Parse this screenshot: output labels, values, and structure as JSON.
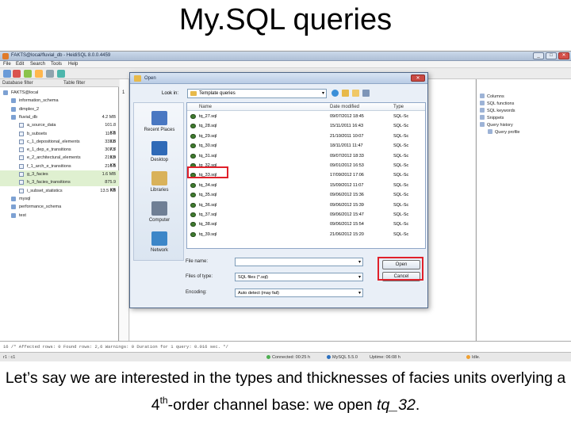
{
  "slide": {
    "title": "My.SQL queries",
    "caption_part1": "Let’s say we are interested in the types and thicknesses of facies units overlying a 4",
    "caption_sup": "th",
    "caption_part2": "-order channel base: we open ",
    "caption_em": "tq_32",
    "caption_end": "."
  },
  "app": {
    "window_title": "FAKTS@local/fluvial_db - HeidiSQL 8.0.0.4459",
    "menu": [
      "File",
      "Edit",
      "Search",
      "Tools",
      "Help"
    ],
    "filter_db": "Database filter",
    "filter_table": "Table filter",
    "tree": [
      {
        "name": "FAKTS@local",
        "size": "",
        "level": 0
      },
      {
        "name": "information_schema",
        "size": "",
        "level": 1
      },
      {
        "name": "dimplex_2",
        "size": "",
        "level": 1
      },
      {
        "name": "fluvial_db",
        "size": "4.2 MB",
        "level": 1
      },
      {
        "name": "a_source_data",
        "size": "101.8 KB",
        "level": 2
      },
      {
        "name": "b_subsets",
        "size": "110.6 KB",
        "level": 2
      },
      {
        "name": "c_1_depositional_elements",
        "size": "333.8 KB",
        "level": 2
      },
      {
        "name": "e_1_dep_e_transitions",
        "size": "307.7 KB",
        "level": 2
      },
      {
        "name": "e_2_architectural_elements",
        "size": "219.9 KB",
        "level": 2
      },
      {
        "name": "f_1_arch_e_transitions",
        "size": "216.5 KB",
        "level": 2
      },
      {
        "name": "g_3_facies",
        "size": "1.6 MB",
        "level": 2
      },
      {
        "name": "h_3_facies_transitions",
        "size": "875.9 KB",
        "level": 2
      },
      {
        "name": "i_subset_statistics",
        "size": "13.5 KB",
        "level": 2
      },
      {
        "name": "mysql",
        "size": "",
        "level": 1
      },
      {
        "name": "performance_schema",
        "size": "",
        "level": 1
      },
      {
        "name": "test",
        "size": "",
        "level": 1
      }
    ],
    "line_number": "1",
    "helpers": [
      "Columns",
      "SQL functions",
      "SQL keywords",
      "Snippets",
      "Query history",
      "Query profile"
    ],
    "log_text": "16 /* Affected rows: 0  Found rows: 2,6  Warnings: 0  Duration for 1 query: 0.016 sec. */",
    "status": {
      "position": "r1 : c1",
      "connected": "Connected: 00:25 h",
      "server": "MySQL 5.5.0",
      "uptime": "Uptime: 06:08 h",
      "state": "Idle."
    }
  },
  "dialog": {
    "title": "Open",
    "close": "✕",
    "look_in_label": "Look in:",
    "look_in_value": "Template queries",
    "places": [
      "Recent Places",
      "Desktop",
      "Libraries",
      "Computer",
      "Network"
    ],
    "columns": [
      "Name",
      "Date modified",
      "Type"
    ],
    "files": [
      {
        "name": "tq_27.sql",
        "date": "09/07/2012 18:45",
        "type": "SQL-Sc"
      },
      {
        "name": "tq_28.sql",
        "date": "15/11/2011 16:43",
        "type": "SQL-Sc"
      },
      {
        "name": "tq_29.sql",
        "date": "21/10/2011 10:07",
        "type": "SQL-Sc"
      },
      {
        "name": "tq_30.sql",
        "date": "18/11/2011 11:47",
        "type": "SQL-Sc"
      },
      {
        "name": "tq_31.sql",
        "date": "09/07/2012 18:33",
        "type": "SQL-Sc"
      },
      {
        "name": "tq_32.sql",
        "date": "09/01/2012 16:53",
        "type": "SQL-Sc"
      },
      {
        "name": "tq_33.sql",
        "date": "17/09/2012 17:06",
        "type": "SQL-Sc"
      },
      {
        "name": "tq_34.sql",
        "date": "15/09/2012 11:07",
        "type": "SQL-Sc"
      },
      {
        "name": "tq_35.sql",
        "date": "09/06/2012 15:36",
        "type": "SQL-Sc"
      },
      {
        "name": "tq_36.sql",
        "date": "09/06/2012 15:39",
        "type": "SQL-Sc"
      },
      {
        "name": "tq_37.sql",
        "date": "09/06/2012 15:47",
        "type": "SQL-Sc"
      },
      {
        "name": "tq_38.sql",
        "date": "09/06/2012 15:54",
        "type": "SQL-Sc"
      },
      {
        "name": "tq_39.sql",
        "date": "21/06/2012 15:20",
        "type": "SQL-Sc"
      }
    ],
    "filename_label": "File name:",
    "filename_value": "",
    "filetype_label": "Files of type:",
    "filetype_value": "SQL files (*.sql)",
    "encoding_label": "Encoding:",
    "encoding_value": "Auto detect (may fail)",
    "open_button": "Open",
    "cancel_button": "Cancel"
  },
  "colors": {
    "highlight": "#e0202a",
    "window_chrome": "#b9cce5",
    "file_icon": "#3f7a2e"
  }
}
